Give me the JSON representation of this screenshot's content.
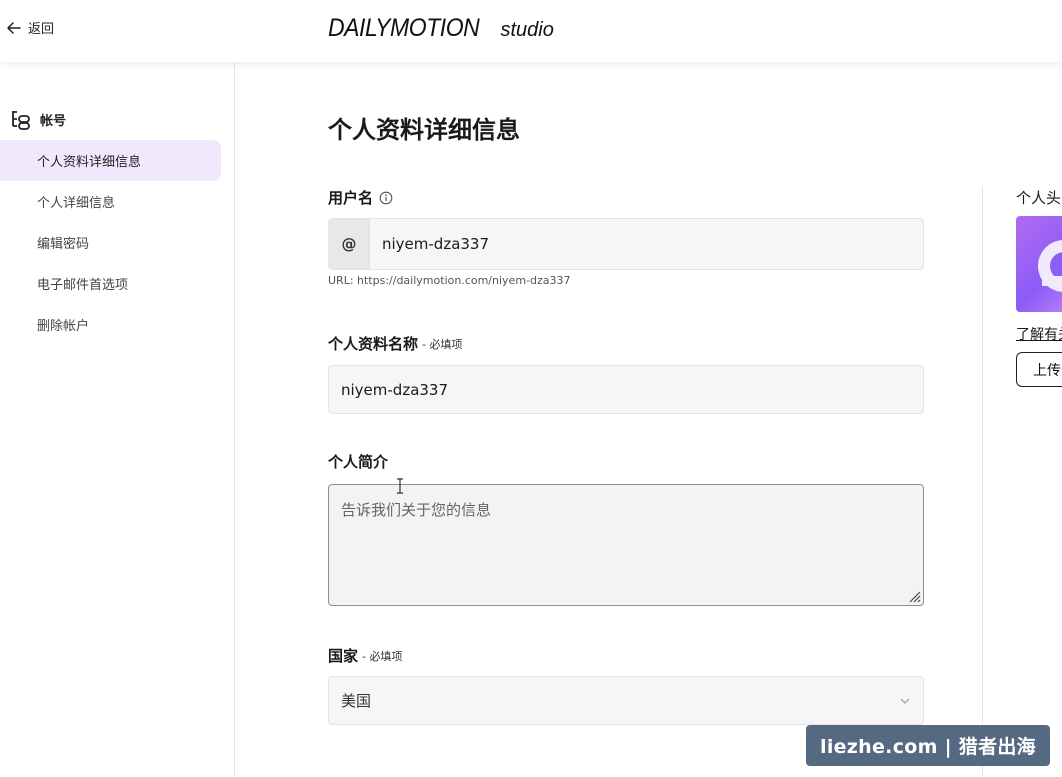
{
  "header": {
    "back_label": "返回",
    "logo_main": "DAILYMOTION",
    "logo_sub": "studio"
  },
  "sidebar": {
    "section_title": "帐号",
    "items": [
      {
        "label": "个人资料详细信息",
        "active": true
      },
      {
        "label": "个人详细信息",
        "active": false
      },
      {
        "label": "编辑密码",
        "active": false
      },
      {
        "label": "电子邮件首选项",
        "active": false
      },
      {
        "label": "删除帐户",
        "active": false
      }
    ]
  },
  "main": {
    "title": "个人资料详细信息",
    "username": {
      "label": "用户名",
      "prefix": "@",
      "value": "niyem-dza337",
      "url_hint": "URL: https://dailymotion.com/niyem-dza337"
    },
    "profile_name": {
      "label": "个人资料名称",
      "required": "- 必填项",
      "value": "niyem-dza337"
    },
    "bio": {
      "label": "个人简介",
      "placeholder": "告诉我们关于您的信息"
    },
    "country": {
      "label": "国家",
      "required": "- 必填项",
      "value": "美国"
    }
  },
  "right": {
    "avatar_label": "个人头",
    "link": "了解有关",
    "upload_button": "上传"
  },
  "watermark": "liezhe.com | 猎者出海",
  "colors": {
    "sidebar_active_bg": "#efe9fb",
    "avatar_gradient": "#8b5cf6",
    "watermark_bg": "#556a82"
  }
}
